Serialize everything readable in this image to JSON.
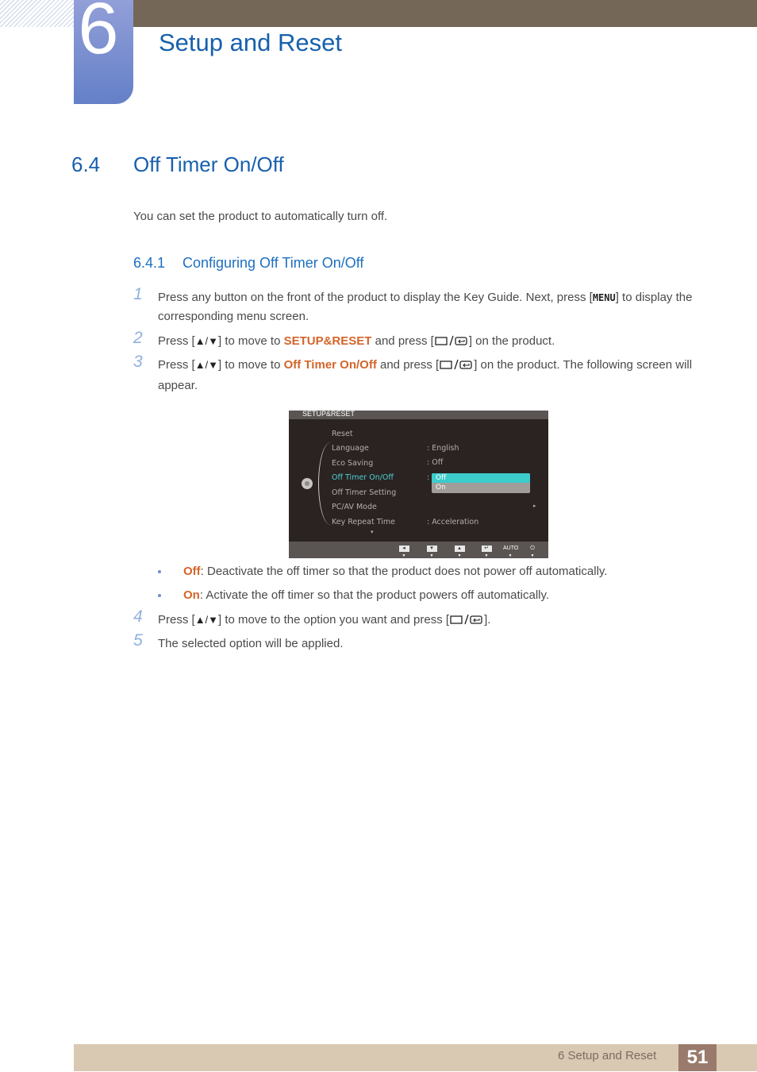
{
  "header": {
    "chapter_number": "6",
    "chapter_title": "Setup and Reset"
  },
  "section": {
    "number": "6.4",
    "title": "Off Timer On/Off",
    "intro": "You can set the product to automatically turn off."
  },
  "subsection": {
    "number": "6.4.1",
    "title": "Configuring Off Timer On/Off"
  },
  "steps": [
    {
      "n": "1",
      "a": "Press any button on the front of the product to display the Key Guide. Next, press [",
      "key": "MENU",
      "b": "] to display the corresponding menu screen."
    },
    {
      "n": "2",
      "a": "Press [",
      "arrows": "▲/▼",
      "b": "] to move to ",
      "hl": "SETUP&RESET",
      "c": " and press [",
      "d": "] on the product."
    },
    {
      "n": "3",
      "a": "Press [",
      "arrows": "▲/▼",
      "b": "] to move to ",
      "hl": "Off Timer On/Off",
      "c": " and press [",
      "d": "] on the product. The following screen will appear."
    },
    {
      "n": "4",
      "a": "Press [",
      "arrows": "▲/▼",
      "b": "] to move to the option you want and press [",
      "d": "]."
    },
    {
      "n": "5",
      "a": "The selected option will be applied."
    }
  ],
  "bullets": [
    {
      "term": "Off",
      "text": ": Deactivate the off timer so that the product does not power off automatically."
    },
    {
      "term": "On",
      "text": ": Activate the off timer so that the product powers off automatically."
    }
  ],
  "osd": {
    "title": "SETUP&RESET",
    "items": [
      {
        "label": "Reset",
        "value": ""
      },
      {
        "label": "Language",
        "value": ":  English"
      },
      {
        "label": "Eco Saving",
        "value": ":  Off"
      },
      {
        "label": "Off Timer On/Off",
        "value": ":",
        "selected": true
      },
      {
        "label": "Off Timer Setting",
        "value": ""
      },
      {
        "label": "PC/AV Mode",
        "value": ""
      },
      {
        "label": "Key Repeat Time",
        "value": ":  Acceleration"
      }
    ],
    "dropdown": [
      "Off",
      "On"
    ],
    "dropdown_selected": "Off",
    "submenu_arrow": "▸",
    "scroll_down": "▾",
    "footer_buttons": [
      {
        "icon": "left-arrow-key-icon",
        "glyph": "◂"
      },
      {
        "icon": "down-arrow-key-icon",
        "glyph": "▾"
      },
      {
        "icon": "up-arrow-key-icon",
        "glyph": "▴"
      },
      {
        "icon": "enter-key-icon",
        "glyph": "↵"
      },
      {
        "icon": "auto-key-icon",
        "glyph": "AUTO"
      },
      {
        "icon": "power-key-icon",
        "glyph": "⏻"
      }
    ]
  },
  "footer": {
    "text": "6 Setup and Reset",
    "page": "51"
  }
}
